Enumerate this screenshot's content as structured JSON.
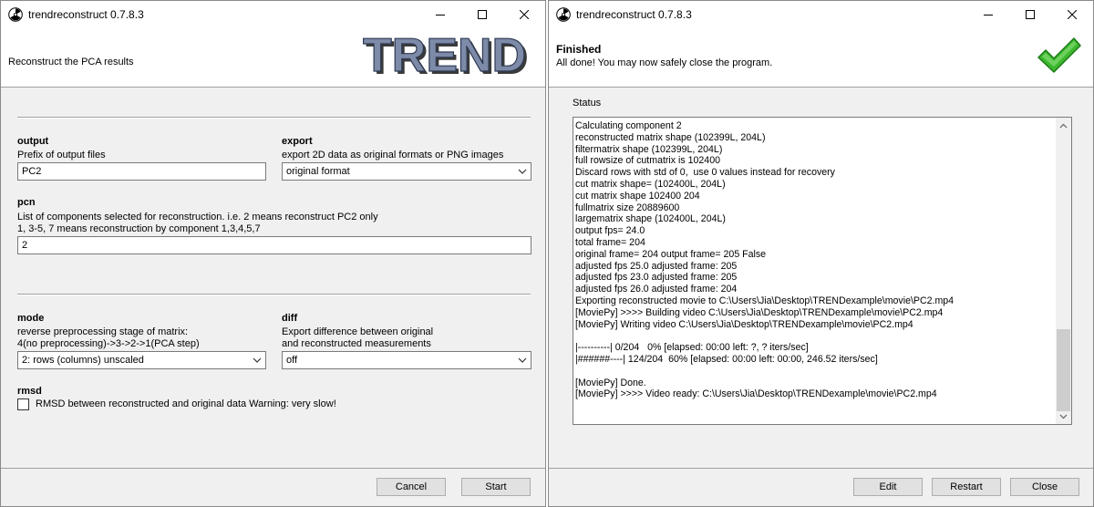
{
  "left": {
    "title": "trendreconstruct 0.7.8.3",
    "subtitle": "Reconstruct the PCA results",
    "logo_text": "TREND",
    "output": {
      "label": "output",
      "help": "Prefix of output files",
      "value": "PC2"
    },
    "export": {
      "label": "export",
      "help": "export 2D data as original formats or PNG images",
      "value": "original format"
    },
    "pcn": {
      "label": "pcn",
      "help_line1": "List of components selected for reconstruction. i.e. 2 means reconstruct PC2 only",
      "help_line2": "1, 3-5, 7 means reconstruction by component 1,3,4,5,7",
      "value": "2"
    },
    "mode": {
      "label": "mode",
      "help_line1": "reverse preprocessing stage of matrix:",
      "help_line2": " 4(no preprocessing)->3->2->1(PCA step)",
      "value": "2: rows (columns) unscaled"
    },
    "diff": {
      "label": "diff",
      "help_line1": "Export difference between original",
      "help_line2": " and reconstructed measurements",
      "value": "off"
    },
    "rmsd": {
      "label": "rmsd",
      "checkbox_label": "RMSD between reconstructed and original data  Warning: very slow!",
      "checked": false
    },
    "buttons": {
      "cancel": "Cancel",
      "start": "Start"
    }
  },
  "right": {
    "title": "trendreconstruct 0.7.8.3",
    "finished_title": "Finished",
    "finished_sub": "All done! You may now safely close the program.",
    "status_label": "Status",
    "status_lines": [
      "Calculating component 2",
      "reconstructed matrix shape (102399L, 204L)",
      "filtermatrix shape (102399L, 204L)",
      "full rowsize of cutmatrix is 102400",
      "Discard rows with std of 0,  use 0 values instead for recovery",
      "cut matrix shape= (102400L, 204L)",
      "cut matrix shape 102400 204",
      "fullmatrix size 20889600",
      "largematrix shape (102400L, 204L)",
      "output fps= 24.0",
      "total frame= 204",
      "original frame= 204 output frame= 205 False",
      "adjusted fps 25.0 adjusted frame: 205",
      "adjusted fps 23.0 adjusted frame: 205",
      "adjusted fps 26.0 adjusted frame: 204",
      "Exporting reconstructed movie to C:\\Users\\Jia\\Desktop\\TRENDexample\\movie\\PC2.mp4",
      "[MoviePy] >>>> Building video C:\\Users\\Jia\\Desktop\\TRENDexample\\movie\\PC2.mp4",
      "[MoviePy] Writing video C:\\Users\\Jia\\Desktop\\TRENDexample\\movie\\PC2.mp4",
      "",
      "|----------| 0/204   0% [elapsed: 00:00 left: ?, ? iters/sec]",
      "|######----| 124/204  60% [elapsed: 00:00 left: 00:00, 246.52 iters/sec]",
      "",
      "[MoviePy] Done.",
      "[MoviePy] >>>> Video ready: C:\\Users\\Jia\\Desktop\\TRENDexample\\movie\\PC2.mp4"
    ],
    "buttons": {
      "edit": "Edit",
      "restart": "Restart",
      "close": "Close"
    }
  },
  "colors": {
    "window_bg": "#f0f0f0",
    "logo_fill": "#7d8aa8",
    "check_green": "#3cb82e"
  },
  "icons": [
    "app-radiation-icon",
    "minimize-icon",
    "maximize-icon",
    "close-icon",
    "chevron-down-icon",
    "checkmark-logo"
  ]
}
